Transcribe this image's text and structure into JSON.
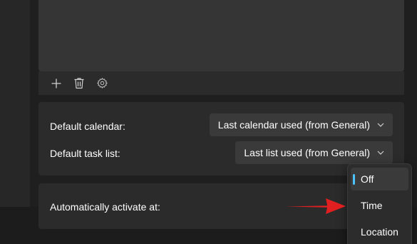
{
  "toolbar": {
    "add_icon": "plus-icon",
    "delete_icon": "trash-icon",
    "settings_icon": "gear-icon"
  },
  "defaults": {
    "calendar_label": "Default calendar:",
    "calendar_value": "Last calendar used (from General)",
    "tasklist_label": "Default task list:",
    "tasklist_value": "Last list used (from General)"
  },
  "activate": {
    "label": "Automatically activate at:"
  },
  "menu": {
    "items": [
      {
        "label": "Off",
        "selected": true
      },
      {
        "label": "Time",
        "selected": false
      },
      {
        "label": "Location",
        "selected": false
      }
    ]
  },
  "colors": {
    "accent": "#4cc2ff",
    "arrow": "#e02020"
  }
}
